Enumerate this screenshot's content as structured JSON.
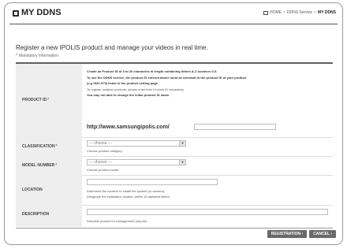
{
  "header": {
    "title": "MY DDNS",
    "breadcrumb": [
      "HOME",
      "DDNS Service",
      "MY DDNS"
    ],
    "breadcrumb_separator": ">"
  },
  "headline": "Register a new IPOLIS product and manage your videos in real time.",
  "mandatory_note": "Mandatory Information",
  "form": {
    "product_id": {
      "label": "PRODUCT ID",
      "notes": [
        "Create an Product ID of 4 to 20 characters in length containing letters A-Z numbers 0-9.",
        "To use the DDNS service, the product ID entered above must be identical to the product ID of your product",
        "(e.g SNC-579) listed in the product setting page.",
        "To register multiple products, please enter their Product ID separately.",
        "You may not able to change the initial product ID name."
      ],
      "url_prefix": "http://www.samsungipolis.com/",
      "value": ""
    },
    "classification": {
      "label": "CLASSIFICATION",
      "selected": "--- choose ---",
      "hint": "Choose product category"
    },
    "model_number": {
      "label": "MODEL NUMBER",
      "selected": "--- choose ---",
      "hint": "Choose product model"
    },
    "location": {
      "label": "LOCATION",
      "value": "",
      "hints": [
        "Determine the location to install the system (or camera).",
        "Designate the installation location within 10 alphabet letters."
      ]
    },
    "description": {
      "label": "DESCRIPTION",
      "value": "",
      "hint": "Describe product for management purpose."
    },
    "required_marker": "*"
  },
  "buttons": {
    "registration": "REGISTRATION",
    "cancel": "CANCEL"
  },
  "colors": {
    "accent_required": "#d04020",
    "button_bg": "#6a6a6a",
    "label_bg": "#eeeeee"
  }
}
